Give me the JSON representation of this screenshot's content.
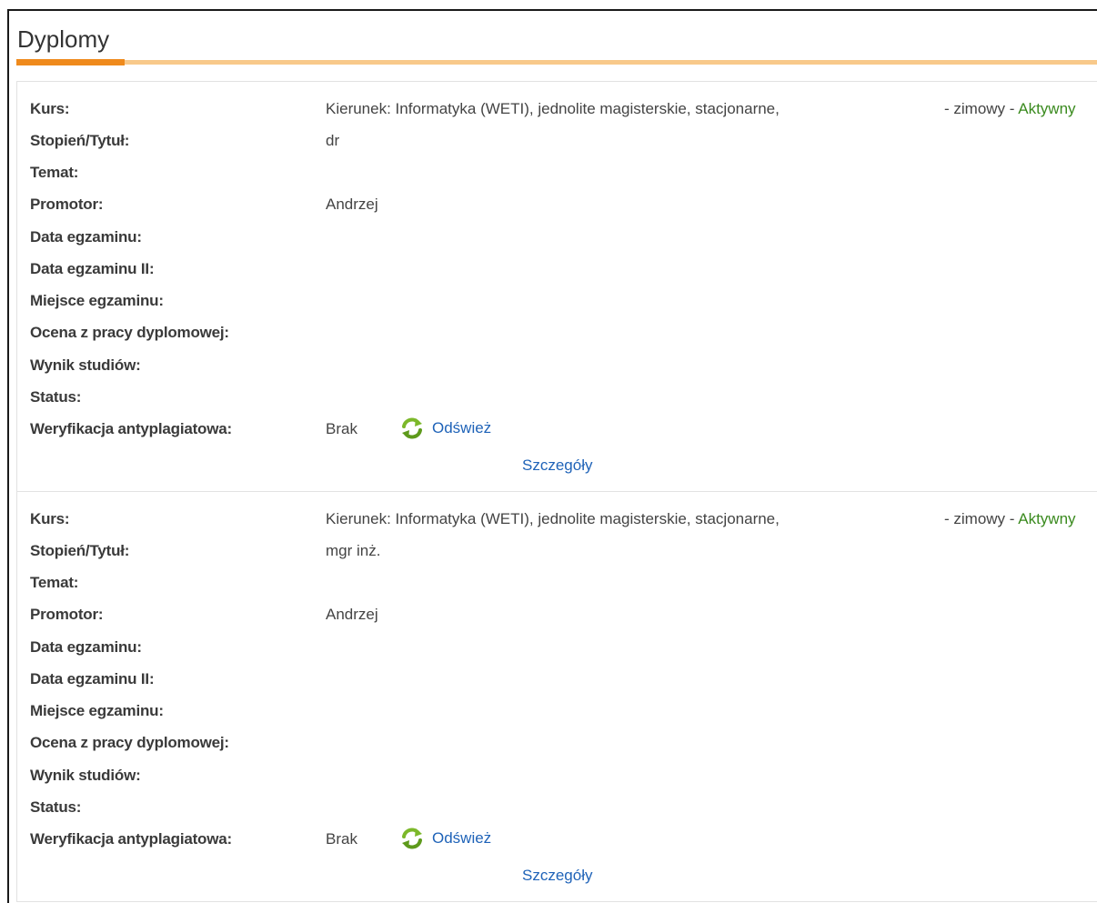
{
  "page": {
    "title": "Dyplomy"
  },
  "labels": {
    "kurs": "Kurs:",
    "stopien": "Stopień/Tytuł:",
    "temat": "Temat:",
    "promotor": "Promotor:",
    "data_egzaminu": "Data egzaminu:",
    "data_egzaminu_2": "Data egzaminu II:",
    "miejsce_egzaminu": "Miejsce egzaminu:",
    "ocena": "Ocena z pracy dyplomowej:",
    "wynik": "Wynik studiów:",
    "status": "Status:",
    "weryfikacja": "Weryfikacja antyplagiatowa:"
  },
  "diplomas": [
    {
      "kurs": "Kierunek: Informatyka (WETI), jednolite magisterskie, stacjonarne,",
      "semester": "- zimowy -",
      "active": "Aktywny",
      "stopien": "dr",
      "promotor": "Andrzej",
      "weryfikacja": "Brak",
      "refresh_label": "Odśwież",
      "details_label": "Szczegóły"
    },
    {
      "kurs": "Kierunek: Informatyka (WETI), jednolite magisterskie, stacjonarne,",
      "semester": "- zimowy -",
      "active": "Aktywny",
      "stopien": "mgr inż.",
      "promotor": "Andrzej",
      "weryfikacja": "Brak",
      "refresh_label": "Odśwież",
      "details_label": "Szczegóły"
    }
  ],
  "colors": {
    "accent": "#ef8a1c",
    "accent_light": "#f8c98a",
    "link": "#1f63b8",
    "active": "#3a8a1e",
    "refresh_icon": "#7cb82a"
  },
  "icons": {
    "refresh": "refresh-icon"
  }
}
